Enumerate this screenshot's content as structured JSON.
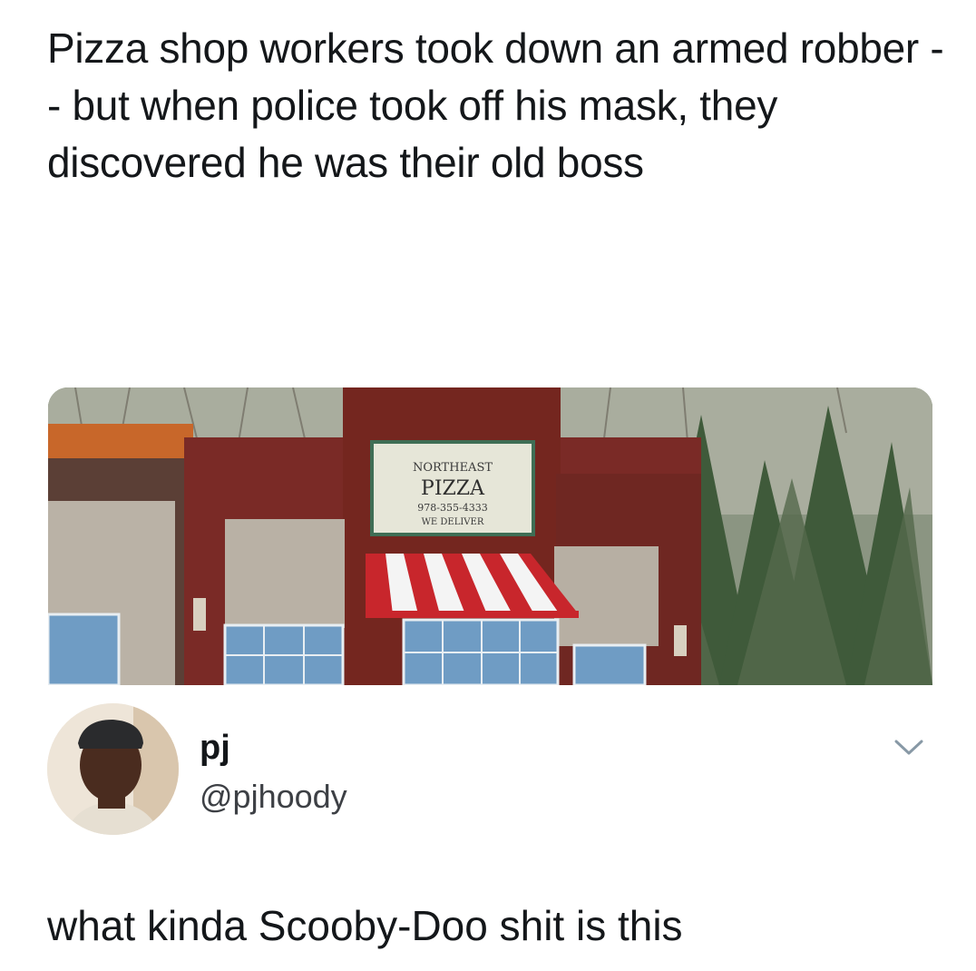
{
  "post": {
    "headline": "Pizza shop workers took down an armed robber -- but when police took off his mask, they discovered he was their old boss",
    "photo": {
      "sign_line1": "NORTHEAST",
      "sign_line2": "PIZZA",
      "sign_line3": "978-355-4333",
      "sign_line4": "WE DELIVER"
    }
  },
  "author": {
    "name": "pj",
    "handle": "@pjhoody",
    "menu_icon": "chevron-down-icon",
    "avatar_icon": "avatar"
  },
  "comment": {
    "text": "what kinda Scooby-Doo shit is this"
  },
  "colors": {
    "text_primary": "#14171a",
    "text_secondary": "#3d4045",
    "building_red": "#7a2a26",
    "awning_red": "#c8262c",
    "chevron": "#8899a6"
  }
}
